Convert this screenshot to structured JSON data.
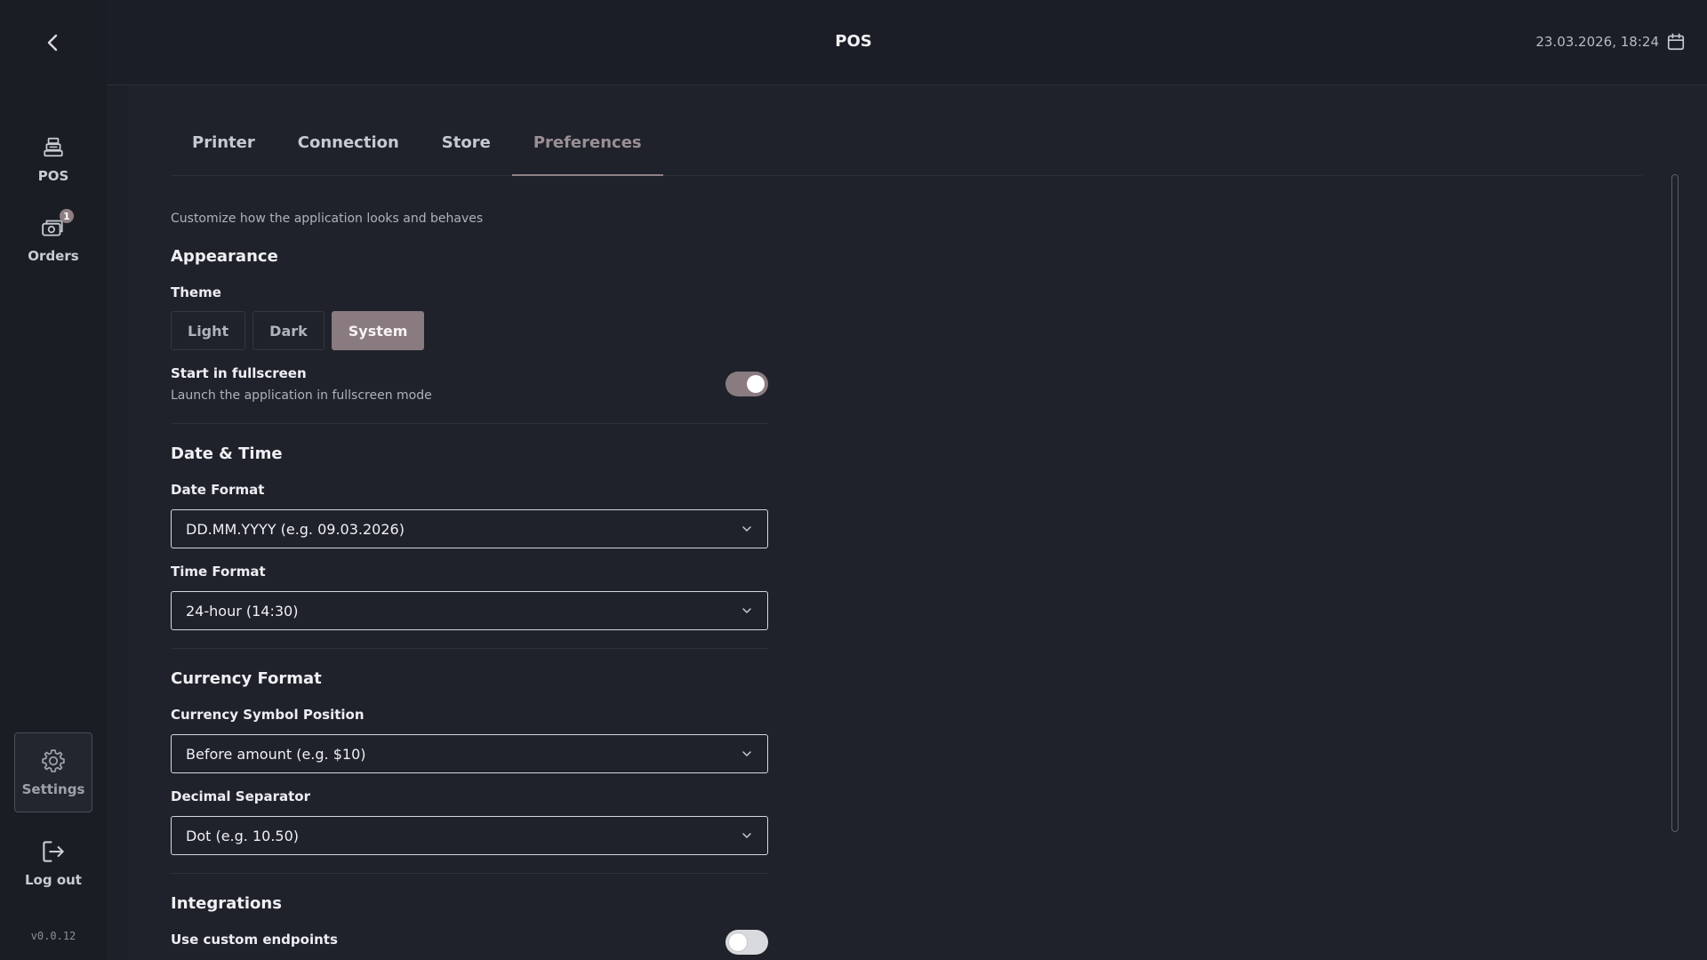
{
  "header": {
    "title": "POS",
    "datetime": "23.03.2026, 18:24",
    "back_icon": "chevron-left-icon",
    "calendar_icon": "calendar-icon"
  },
  "sidebar": {
    "items": [
      {
        "label": "POS",
        "icon": "cash-register-icon"
      },
      {
        "label": "Orders",
        "icon": "orders-icon",
        "badge": "1"
      }
    ],
    "settings": {
      "label": "Settings",
      "icon": "gear-icon"
    },
    "logout": {
      "label": "Log out",
      "icon": "logout-icon"
    },
    "version": "v0.0.12"
  },
  "tabs": [
    {
      "label": "Printer"
    },
    {
      "label": "Connection"
    },
    {
      "label": "Store"
    },
    {
      "label": "Preferences",
      "active": true
    }
  ],
  "preferences": {
    "subtitle": "Customize how the application looks and behaves",
    "appearance": {
      "title": "Appearance",
      "theme_label": "Theme",
      "theme_options": [
        "Light",
        "Dark",
        "System"
      ],
      "theme_selected": "System",
      "fullscreen_title": "Start in fullscreen",
      "fullscreen_desc": "Launch the application in fullscreen mode",
      "fullscreen_enabled": true
    },
    "datetime": {
      "title": "Date & Time",
      "date_format_label": "Date Format",
      "date_format_value": "DD.MM.YYYY (e.g. 09.03.2026)",
      "time_format_label": "Time Format",
      "time_format_value": "24-hour (14:30)"
    },
    "currency": {
      "title": "Currency Format",
      "symbol_position_label": "Currency Symbol Position",
      "symbol_position_value": "Before amount (e.g. $10)",
      "decimal_separator_label": "Decimal Separator",
      "decimal_separator_value": "Dot (e.g. 10.50)"
    },
    "integrations": {
      "title": "Integrations",
      "custom_endpoints_label": "Use custom endpoints",
      "custom_endpoints_enabled": false
    }
  },
  "colors": {
    "accent": "#8a7b80",
    "background": "#1f222b",
    "sidebar": "#1a1d24"
  }
}
